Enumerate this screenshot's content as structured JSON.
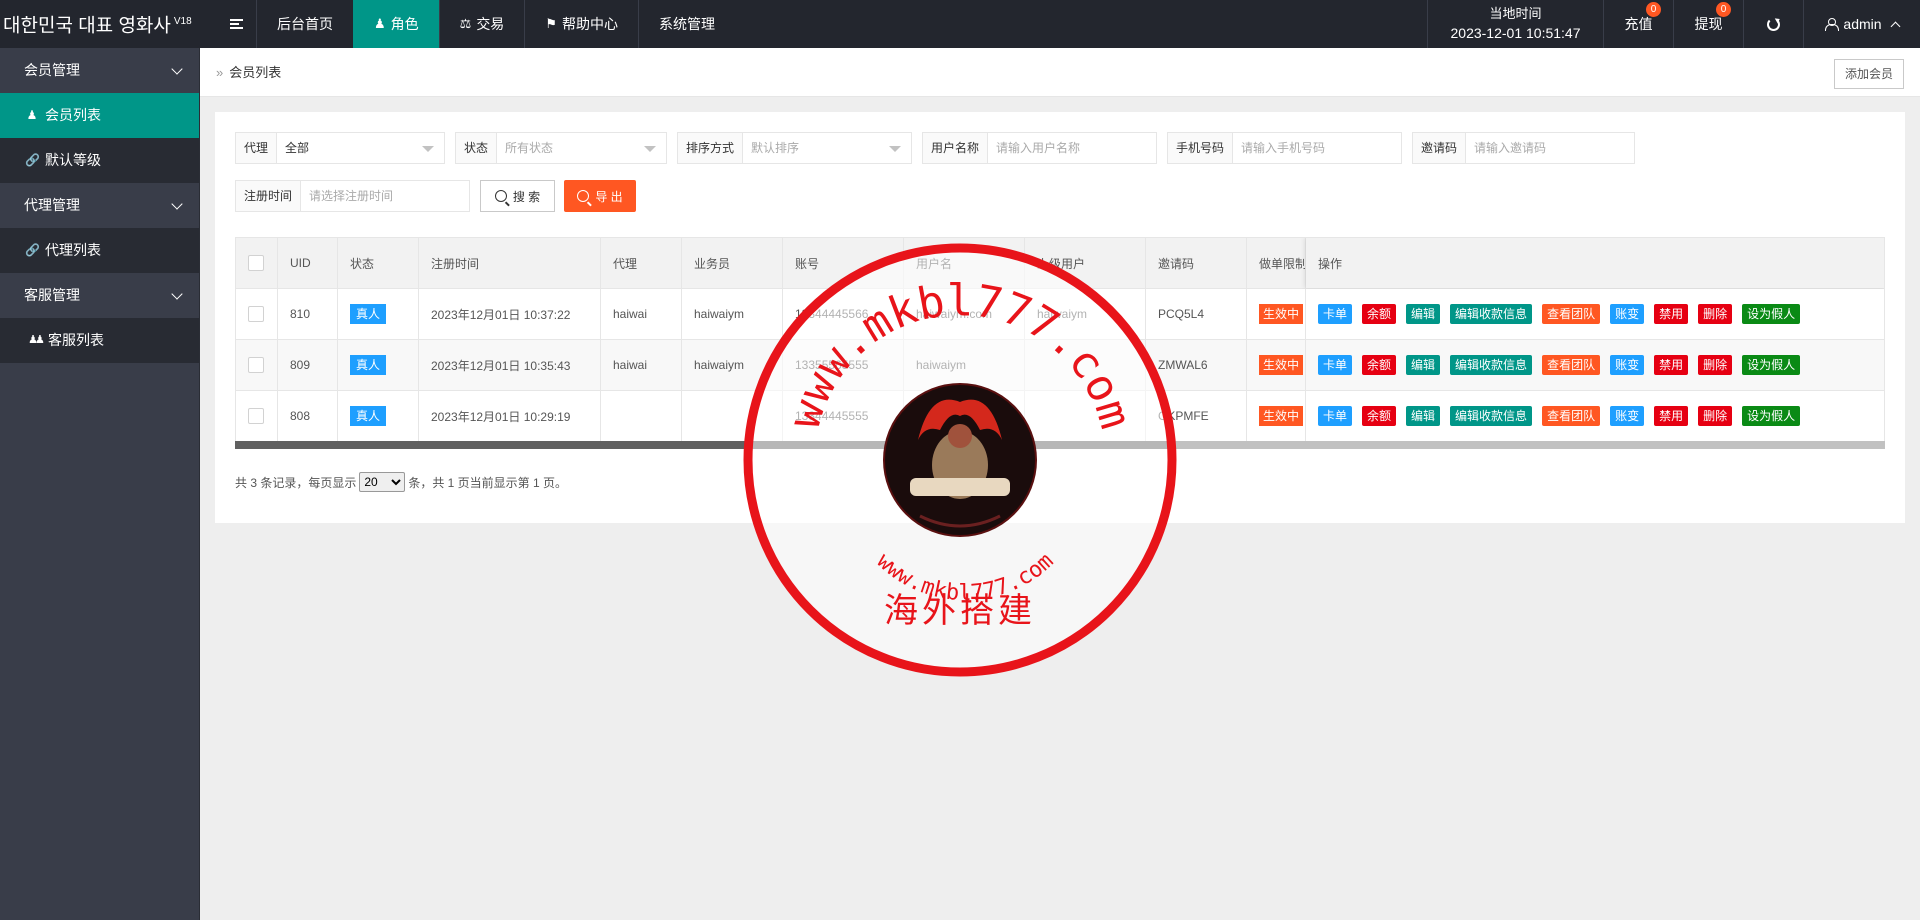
{
  "header": {
    "logo": "대한민국 대표 영화사",
    "version": "V18",
    "nav": [
      {
        "label": "后台首页",
        "icon": ""
      },
      {
        "label": "角色",
        "icon": "user-icon"
      },
      {
        "label": "交易",
        "icon": "scale-icon"
      },
      {
        "label": "帮助中心",
        "icon": "flag-icon"
      },
      {
        "label": "系统管理",
        "icon": ""
      }
    ],
    "time_label": "当地时间",
    "time_value": "2023-12-01 10:51:47",
    "recharge": "充值",
    "recharge_badge": "0",
    "withdraw": "提现",
    "withdraw_badge": "0",
    "user": "admin"
  },
  "sidebar": {
    "groups": [
      {
        "label": "会员管理",
        "items": [
          {
            "label": "会员列表",
            "icon": "user-icon"
          },
          {
            "label": "默认等级",
            "icon": "link-icon"
          }
        ]
      },
      {
        "label": "代理管理",
        "items": [
          {
            "label": "代理列表",
            "icon": "link-icon"
          }
        ]
      },
      {
        "label": "客服管理",
        "items": [
          {
            "label": "客服列表",
            "icon": "users-icon"
          }
        ]
      }
    ]
  },
  "breadcrumb": {
    "current": "会员列表",
    "add_button": "添加会员"
  },
  "filters": {
    "agent": {
      "label": "代理",
      "value": "全部"
    },
    "status": {
      "label": "状态",
      "placeholder": "所有状态"
    },
    "sort": {
      "label": "排序方式",
      "placeholder": "默认排序"
    },
    "username": {
      "label": "用户名称",
      "placeholder": "请输入用户名称"
    },
    "phone": {
      "label": "手机号码",
      "placeholder": "请输入手机号码"
    },
    "invite": {
      "label": "邀请码",
      "placeholder": "请输入邀请码"
    },
    "regtime": {
      "label": "注册时间",
      "placeholder": "请选择注册时间"
    },
    "search_button": "搜 索",
    "export_button": "导 出"
  },
  "table": {
    "headers": [
      "UID",
      "状态",
      "注册时间",
      "代理",
      "业务员",
      "账号",
      "用户名",
      "上级用户",
      "邀请码",
      "做单限制",
      "操作"
    ],
    "rows": [
      {
        "uid": "810",
        "status": "真人",
        "regtime": "2023年12月01日 10:37:22",
        "agent": "haiwai",
        "salesman": "haiwaiym",
        "account": "13344445566",
        "username": "haiwaiym.com",
        "parent": "haiwaiym",
        "invite": "PCQ5L4",
        "limit": "生效中"
      },
      {
        "uid": "809",
        "status": "真人",
        "regtime": "2023年12月01日 10:35:43",
        "agent": "haiwai",
        "salesman": "haiwaiym",
        "account": "13355565555",
        "username": "haiwaiym",
        "parent": "",
        "invite": "ZMWAL6",
        "limit": "生效中"
      },
      {
        "uid": "808",
        "status": "真人",
        "regtime": "2023年12月01日 10:29:19",
        "agent": "",
        "salesman": "",
        "account": "13344445555",
        "username": "",
        "parent": "",
        "invite": "GKPMFE",
        "limit": "生效中"
      }
    ],
    "ops": [
      {
        "label": "卡单",
        "color": "#1e9fff"
      },
      {
        "label": "余额",
        "color": "#e60012"
      },
      {
        "label": "编辑",
        "color": "#009688"
      },
      {
        "label": "编辑收款信息",
        "color": "#009688"
      },
      {
        "label": "查看团队",
        "color": "#ff5722"
      },
      {
        "label": "账变",
        "color": "#1e9fff"
      },
      {
        "label": "禁用",
        "color": "#e60012"
      },
      {
        "label": "删除",
        "color": "#e60012"
      },
      {
        "label": "设为假人",
        "color": "#0a8a15"
      }
    ]
  },
  "pager": {
    "prefix": "共 3 条记录，每页显示",
    "page_size": "20",
    "suffix": "条，共 1 页当前显示第 1 页。"
  },
  "watermark": {
    "ring_text": "www.mkbl777.com",
    "center_text": "海外搭建",
    "bottom_text": "www.mkbl777.com"
  },
  "colors": {
    "header_bg": "#23262e",
    "sidebar_bg": "#393d49",
    "accent": "#009688",
    "orange": "#ff5722",
    "blue": "#1e9fff"
  }
}
